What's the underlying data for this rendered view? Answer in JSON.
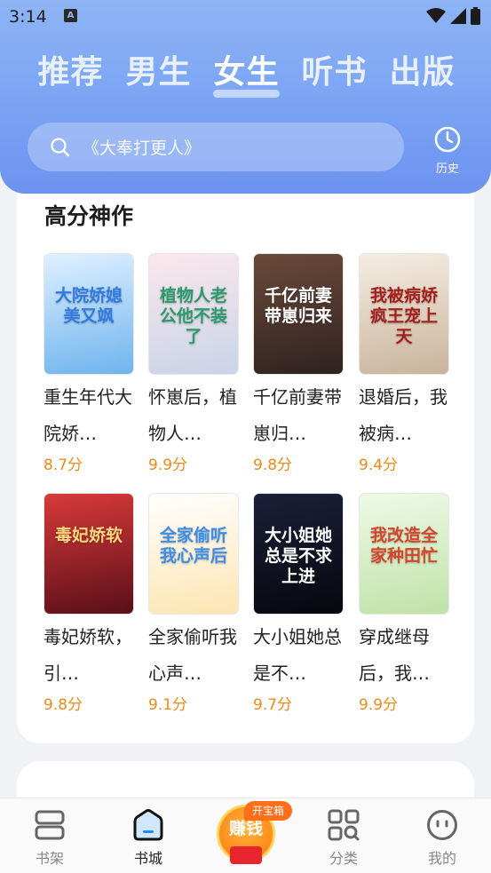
{
  "status": {
    "time": "3:14",
    "notification_letter": "A"
  },
  "tabs": [
    {
      "label": "推荐",
      "active": false
    },
    {
      "label": "男生",
      "active": false
    },
    {
      "label": "女生",
      "active": true
    },
    {
      "label": "听书",
      "active": false
    },
    {
      "label": "出版",
      "active": false
    }
  ],
  "search": {
    "placeholder": "《大奉打更人》",
    "icon": "search-icon"
  },
  "history": {
    "label": "历史",
    "icon": "clock-icon"
  },
  "section": {
    "title": "高分神作"
  },
  "books": [
    {
      "title": "重生年代大院娇…",
      "score": "8.7分",
      "cover_text": "大院娇媳美又飒",
      "cover_colors": [
        "#dff0ff",
        "#6fb4ee"
      ],
      "text_color": "#2f7ce0"
    },
    {
      "title": "怀崽后，植物人…",
      "score": "9.9分",
      "cover_text": "植物人老公他不装了",
      "cover_colors": [
        "#fbe7ec",
        "#c9d4e8"
      ],
      "text_color": "#2b9a6c"
    },
    {
      "title": "千亿前妻带崽归…",
      "score": "9.8分",
      "cover_text": "千亿前妻带崽归来",
      "cover_colors": [
        "#6a4a3a",
        "#2f2220"
      ],
      "text_color": "#ffffff"
    },
    {
      "title": "退婚后，我被病…",
      "score": "9.4分",
      "cover_text": "我被病娇疯王宠上天",
      "cover_colors": [
        "#f5ede2",
        "#c9b49c"
      ],
      "text_color": "#a5201d"
    },
    {
      "title": "毒妃娇软，引…",
      "score": "9.8分",
      "cover_text": "毒妃娇软",
      "cover_colors": [
        "#d83a3a",
        "#5a0f18"
      ],
      "text_color": "#ffd67a"
    },
    {
      "title": "全家偷听我心声…",
      "score": "9.1分",
      "cover_text": "全家偷听我心声后",
      "cover_colors": [
        "#ffffff",
        "#fde5b2"
      ],
      "text_color": "#3c8de8"
    },
    {
      "title": "大小姐她总是不…",
      "score": "9.7分",
      "cover_text": "大小姐她总是不求上进",
      "cover_colors": [
        "#1a2038",
        "#07070f"
      ],
      "text_color": "#ffffff"
    },
    {
      "title": "穿成继母后，我…",
      "score": "9.9分",
      "cover_text": "我改造全家种田忙",
      "cover_colors": [
        "#eef9e6",
        "#bfe3a8"
      ],
      "text_color": "#d4452c"
    }
  ],
  "nav": [
    {
      "label": "书架",
      "icon": "bookshelf-icon",
      "active": false
    },
    {
      "label": "书城",
      "icon": "bookstore-home-icon",
      "active": true
    },
    {
      "label": "分类",
      "icon": "category-grid-icon",
      "active": false
    },
    {
      "label": "我的",
      "icon": "profile-face-icon",
      "active": false
    }
  ],
  "earn": {
    "label": "赚钱",
    "badge": "开宝箱"
  }
}
